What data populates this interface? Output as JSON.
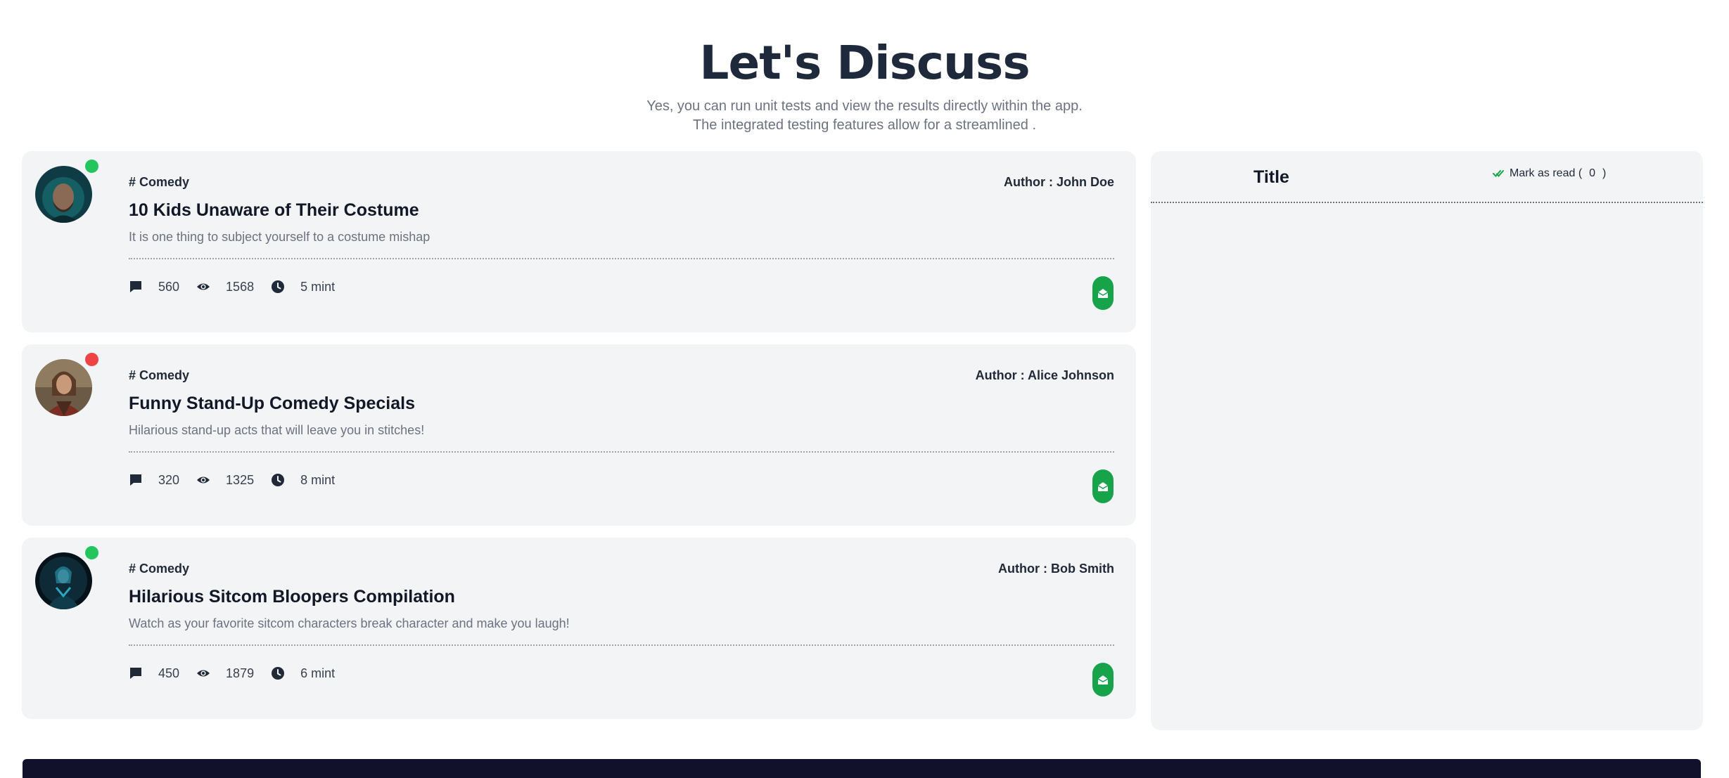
{
  "header": {
    "title": "Let's Discuss",
    "subtitle_line1": "Yes, you can run unit tests and view the results directly within the app.",
    "subtitle_line2": "The integrated testing features allow for a streamlined ."
  },
  "posts": [
    {
      "status": "online",
      "category": "# Comedy",
      "author": "Author : John Doe",
      "title": "10 Kids Unaware of Their Costume",
      "excerpt": "It is one thing to subject yourself to a costume mishap",
      "comments": "560",
      "views": "1568",
      "read_time": "5 mint"
    },
    {
      "status": "offline",
      "category": "# Comedy",
      "author": "Author : Alice Johnson",
      "title": "Funny Stand-Up Comedy Specials",
      "excerpt": "Hilarious stand-up acts that will leave you in stitches!",
      "comments": "320",
      "views": "1325",
      "read_time": "8 mint"
    },
    {
      "status": "online",
      "category": "# Comedy",
      "author": "Author : Bob Smith",
      "title": "Hilarious Sitcom Bloopers Compilation",
      "excerpt": "Watch as your favorite sitcom characters break character and make you laugh!",
      "comments": "450",
      "views": "1879",
      "read_time": "6 mint"
    }
  ],
  "sidebar": {
    "title": "Title",
    "mark_read_label": "Mark as read (",
    "mark_read_count": "0",
    "mark_read_close": ")"
  },
  "icons": {
    "comment": "comment-icon",
    "views": "eye-icon",
    "time": "clock-icon",
    "mail": "envelope-open-icon",
    "check": "double-check-icon"
  },
  "colors": {
    "accent_green": "#16a34a",
    "online": "#22c55e",
    "offline": "#ef4444",
    "card_bg": "#f3f4f6",
    "footer": "#11112b"
  }
}
